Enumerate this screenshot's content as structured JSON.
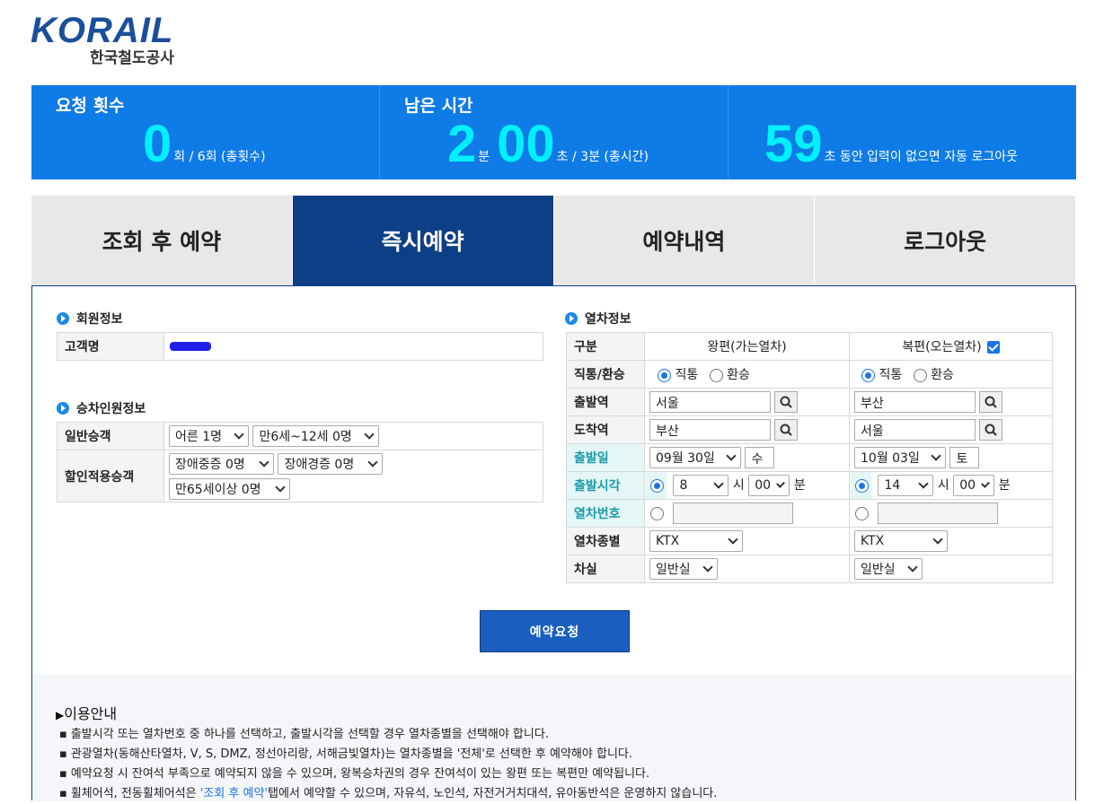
{
  "logo": {
    "word": "KORAIL",
    "sub": "한국철도공사"
  },
  "stats": {
    "requests": {
      "label": "요청 횟수",
      "value": "0",
      "suffix": "회 / 6회 (총횟수)"
    },
    "remaining": {
      "label": "남은 시간",
      "minutes": "2",
      "min_unit": "분",
      "seconds": "00",
      "suffix": "초 / 3분 (총시간)"
    },
    "logout": {
      "value": "59",
      "suffix": "초 동안 입력이 없으면 자동 로그아웃"
    }
  },
  "tabs": [
    {
      "label": "조회 후 예약"
    },
    {
      "label": "즉시예약"
    },
    {
      "label": "예약내역"
    },
    {
      "label": "로그아웃"
    }
  ],
  "member": {
    "title": "회원정보",
    "name_label": "고객명"
  },
  "passenger": {
    "title": "승차인원정보",
    "general_label": "일반승객",
    "discount_label": "할인적용승객",
    "adult": "어른 1명",
    "child": "만6세~12세 0명",
    "severe": "장애중증 0명",
    "mild": "장애경증 0명",
    "senior": "만65세이상 0명"
  },
  "train": {
    "title": "열차정보",
    "h_type": "구분",
    "h_outbound": "왕편(가는열차)",
    "h_return": "복편(오는열차)",
    "row_direct": "직통/환승",
    "direct": "직통",
    "transfer": "환승",
    "row_dep_station": "출발역",
    "row_arr_station": "도착역",
    "row_dep_date": "출발일",
    "row_dep_time": "출발시각",
    "row_train_no": "열차번호",
    "row_train_type": "열차종별",
    "row_class": "차실",
    "hour_unit": "시",
    "min_unit": "분",
    "out": {
      "dep": "서울",
      "arr": "부산",
      "date": "09월 30일",
      "day": "수",
      "hour": "8",
      "minute": "00",
      "type": "KTX",
      "class": "일반실"
    },
    "ret": {
      "dep": "부산",
      "arr": "서울",
      "date": "10월 03일",
      "day": "토",
      "hour": "14",
      "minute": "00",
      "type": "KTX",
      "class": "일반실"
    }
  },
  "request_button": "예약요청",
  "guide": {
    "title": "이용안내",
    "items": [
      "출발시각 또는 열차번호 중 하나를 선택하고, 출발시각을 선택할 경우 열차종별을 선택해야 합니다.",
      "관광열차(동해산타열차, V, S, DMZ, 정선아리랑, 서해금빛열차)는 열차종별을 '전체'로 선택한 후 예약해야 합니다.",
      "예약요청 시 잔여석 부족으로 예약되지 않을 수 있으며, 왕복승차권의 경우 잔여석이 있는 왕편 또는 복편만 예약됩니다."
    ],
    "last_pre": "휠체어석, 전동휠체어석은 ",
    "last_link": "'조회 후 예약'",
    "last_post": "탭에서 예약할 수 있으며, 자유석, 노인석, 자전거거치대석, 유아동반석은 운영하지 않습니다."
  },
  "colors": {
    "accent": "#0e7be6",
    "dark": "#0d3f86",
    "highlight": "#00f0ff"
  }
}
